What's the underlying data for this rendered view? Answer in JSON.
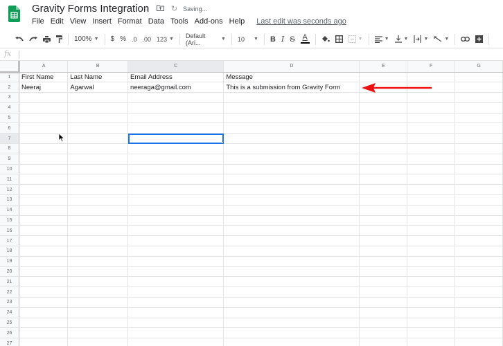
{
  "app": {
    "title": "Gravity Forms Integration",
    "status": "Saving...",
    "last_edit": "Last edit was seconds ago",
    "brand_color": "#0f9d58",
    "selection_color": "#1a73e8",
    "annotation_color": "#ee1111"
  },
  "menu": [
    "File",
    "Edit",
    "View",
    "Insert",
    "Format",
    "Data",
    "Tools",
    "Add-ons",
    "Help"
  ],
  "toolbar": {
    "undo": "undo-icon",
    "redo": "redo-icon",
    "print": "print-icon",
    "paint_format": "paint-format-icon",
    "zoom": "100%",
    "currency": "$",
    "percent": "%",
    "decrease_decimal": ".0",
    "increase_decimal": ".00",
    "more_formats": "123",
    "font": "Default (Ari...",
    "font_size": "10",
    "bold": "B",
    "italic": "I",
    "strikethrough": "S",
    "text_color": "A"
  },
  "formula_bar": {
    "label": "fx",
    "value": ""
  },
  "sheet": {
    "columns": [
      "A",
      "B",
      "C",
      "D",
      "E",
      "F",
      "G"
    ],
    "rows": [
      [
        "First Name",
        "Last Name",
        "Email Address",
        "Message",
        "",
        "",
        ""
      ],
      [
        "Neeraj",
        "Agarwal",
        "neeraga@gmail.com",
        "This is a submission from Gravity Form",
        "",
        "",
        ""
      ]
    ],
    "row_count": 27,
    "selected_cell": "C7"
  }
}
